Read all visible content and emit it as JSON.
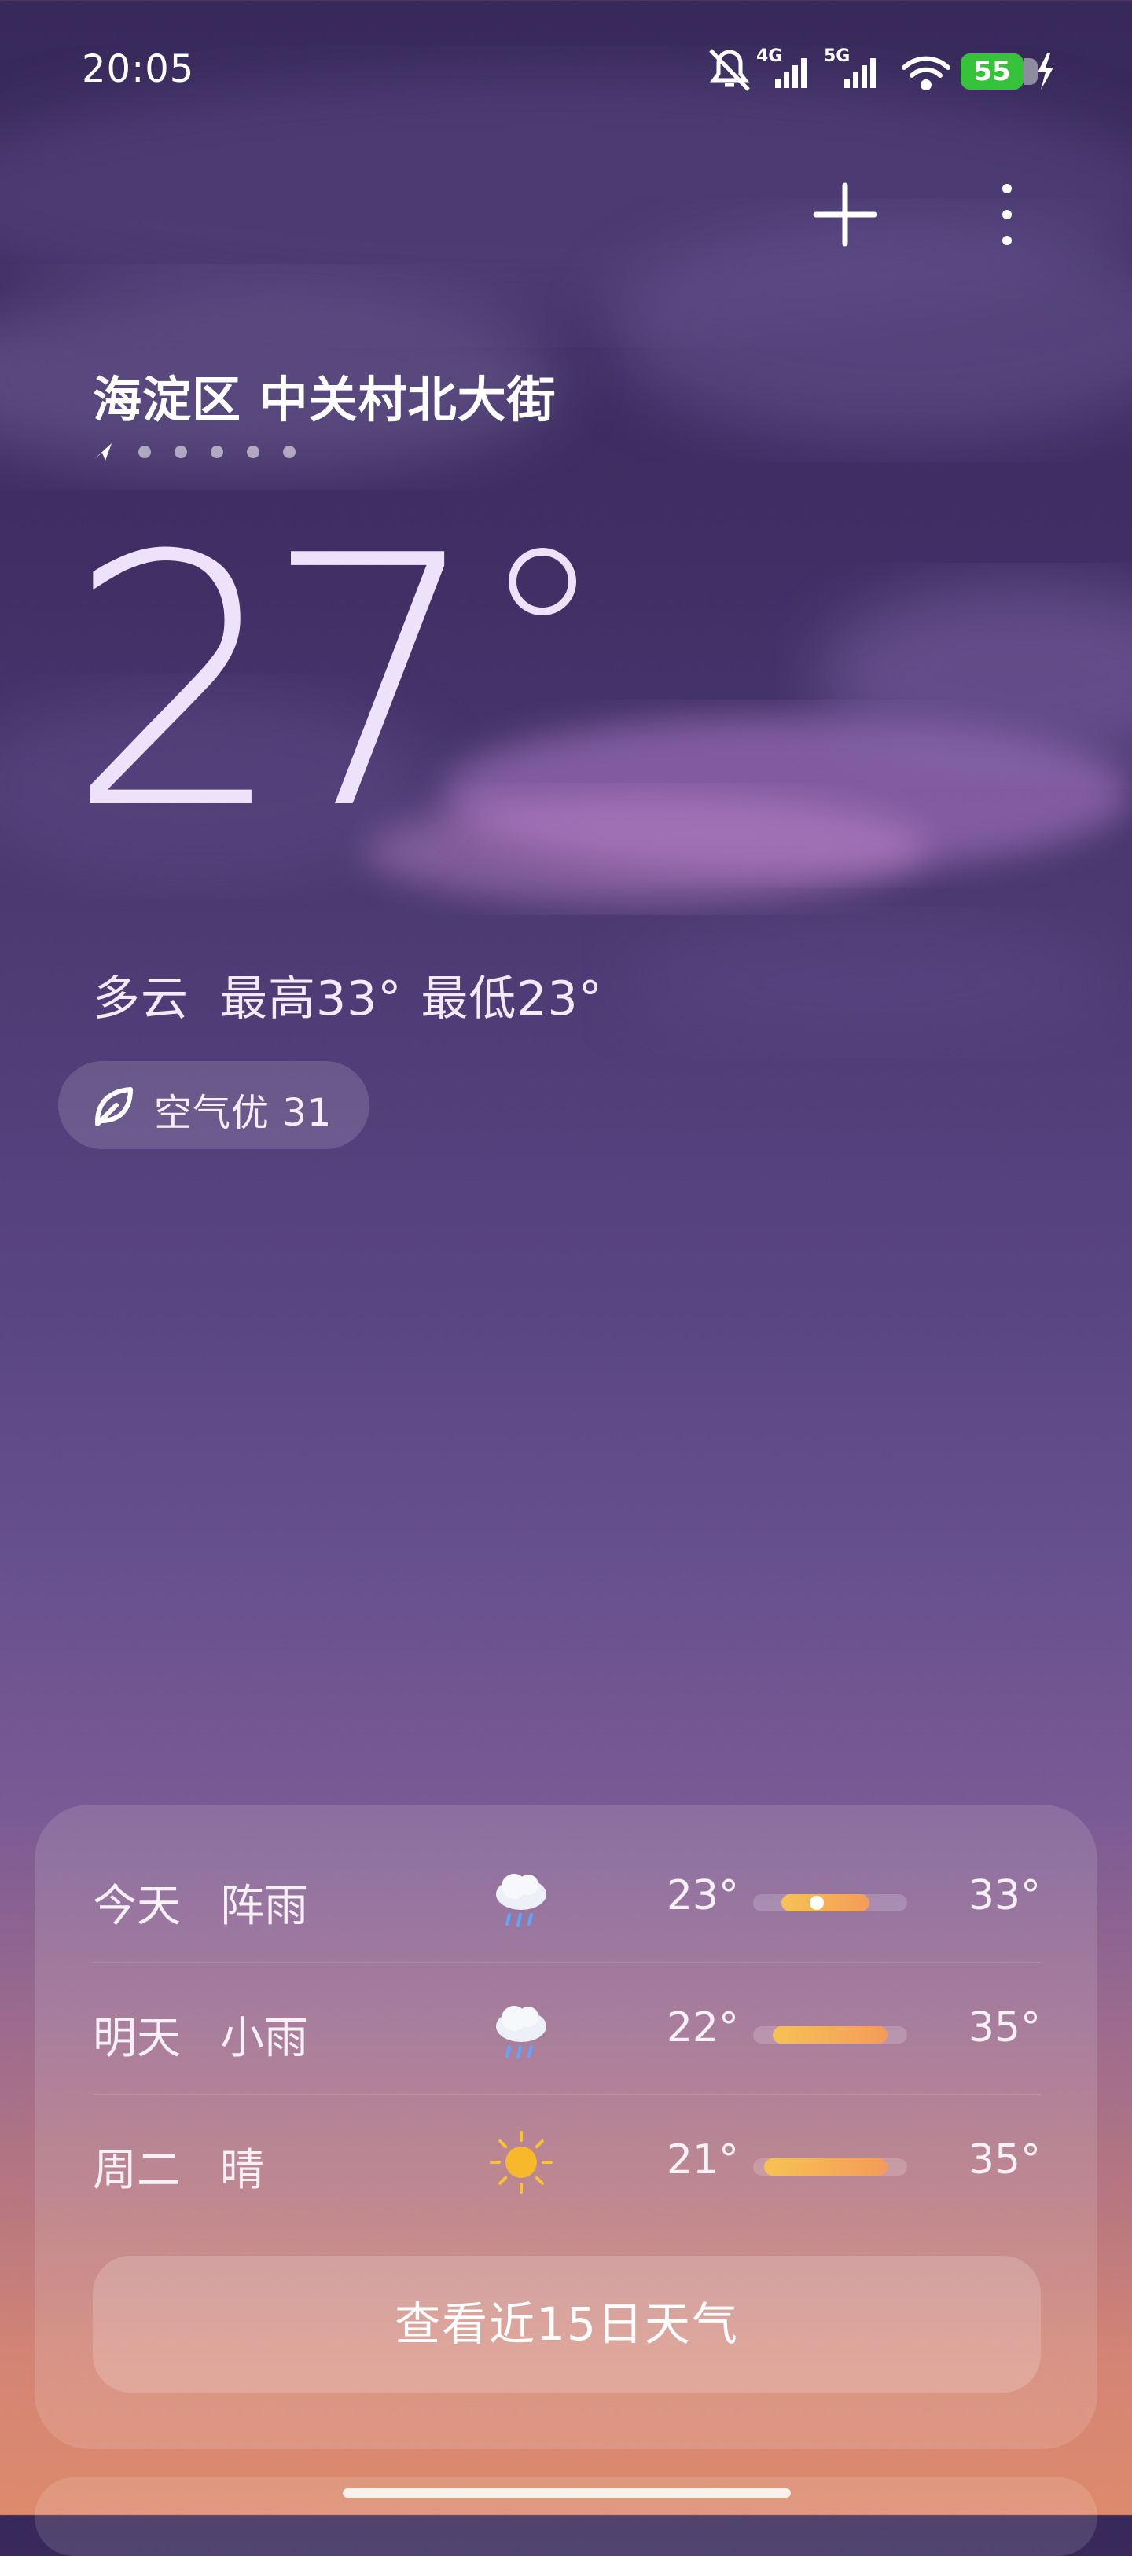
{
  "status_bar": {
    "time": "20:05",
    "network_1": "4G",
    "network_2": "5G",
    "battery": "55",
    "icons": [
      "bell-muted-icon",
      "signal-4g-icon",
      "signal-5g-icon",
      "wifi-icon",
      "battery-icon",
      "charging-icon"
    ]
  },
  "header": {
    "location": "海淀区 中关村北大街",
    "actions": [
      "add-icon",
      "more-icon"
    ],
    "page_count": 6,
    "current_page": 0
  },
  "current": {
    "temperature": "27",
    "condition": "多云",
    "high": "最高33°",
    "low": "最低23°",
    "aqi_label": "空气优 31"
  },
  "forecast": {
    "days": [
      {
        "day": "今天",
        "condition": "阵雨",
        "icon": "rain-cloud-icon",
        "low": "23°",
        "high": "33°",
        "low_value": 23,
        "high_value": 33,
        "current_value": 27
      },
      {
        "day": "明天",
        "condition": "小雨",
        "icon": "rain-cloud-icon",
        "low": "22°",
        "high": "35°",
        "low_value": 22,
        "high_value": 35
      },
      {
        "day": "周二",
        "condition": "晴",
        "icon": "sun-icon",
        "low": "21°",
        "high": "35°",
        "low_value": 21,
        "high_value": 35
      }
    ],
    "range_min": 21,
    "range_max": 35,
    "more_button": "查看近15日天气"
  },
  "colors": {
    "accent_bar_start": "#f6c253",
    "accent_bar_end": "#f59b5a",
    "battery": "#36c23b"
  }
}
